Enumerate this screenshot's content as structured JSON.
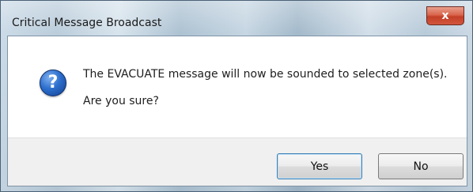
{
  "window": {
    "title": "Critical Message Broadcast",
    "close_glyph": "x"
  },
  "dialog": {
    "icon": "question-icon",
    "icon_glyph": "?",
    "message": "The EVACUATE message will now be sounded to selected zone(s).",
    "confirm": "Are you sure?"
  },
  "buttons": {
    "yes_label": "Yes",
    "no_label": "No"
  },
  "colors": {
    "close_button": "#c9452e",
    "icon_blue": "#2d6fce",
    "footer_bg": "#f0f0f0"
  }
}
